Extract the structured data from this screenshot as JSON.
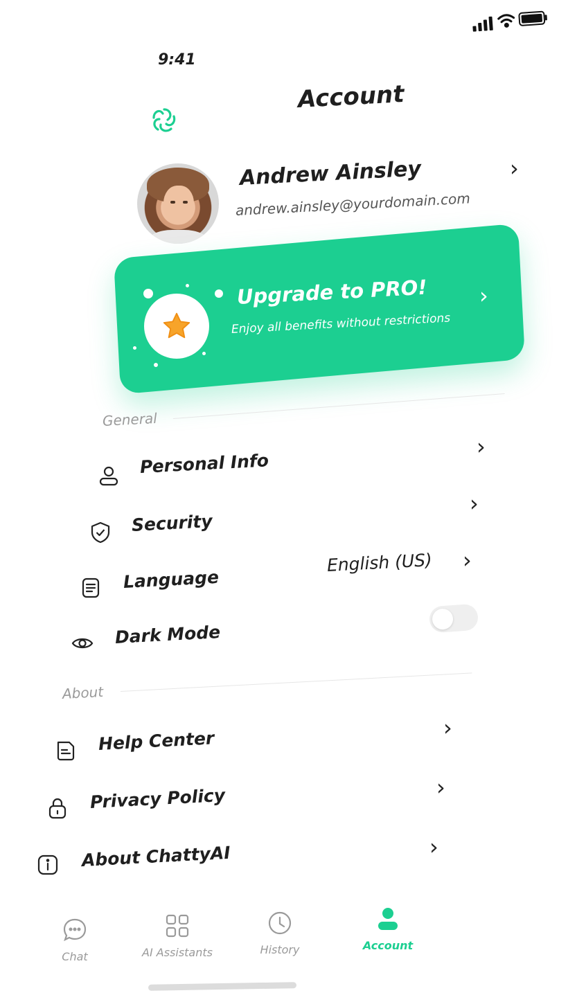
{
  "status_bar": {
    "time": "9:41"
  },
  "header": {
    "title": "Account",
    "logo_icon": "chatty-logo-icon"
  },
  "profile": {
    "name": "Andrew Ainsley",
    "email": "andrew.ainsley@yourdomain.com"
  },
  "promo": {
    "title": "Upgrade to PRO!",
    "subtitle": "Enjoy all benefits without restrictions",
    "color": "#1ccf91"
  },
  "general": {
    "label": "General",
    "items": [
      {
        "label": "Personal Info",
        "icon": "user-icon"
      },
      {
        "label": "Security",
        "icon": "shield-icon"
      },
      {
        "label": "Language",
        "icon": "document-icon",
        "value": "English (US)"
      },
      {
        "label": "Dark Mode",
        "icon": "eye-icon",
        "toggle": false
      }
    ]
  },
  "about": {
    "label": "About",
    "items": [
      {
        "label": "Help Center",
        "icon": "help-document-icon"
      },
      {
        "label": "Privacy Policy",
        "icon": "lock-icon"
      },
      {
        "label": "About ChattyAI",
        "icon": "info-icon"
      }
    ]
  },
  "bottom_nav": {
    "items": [
      {
        "label": "Chat",
        "icon": "chat-bubble-icon",
        "active": false
      },
      {
        "label": "AI Assistants",
        "icon": "grid-icon",
        "active": false
      },
      {
        "label": "History",
        "icon": "clock-icon",
        "active": false
      },
      {
        "label": "Account",
        "icon": "account-icon",
        "active": true
      }
    ]
  },
  "colors": {
    "accent": "#1ccf91",
    "text": "#1f1f1f",
    "muted": "#9a9a9a"
  }
}
